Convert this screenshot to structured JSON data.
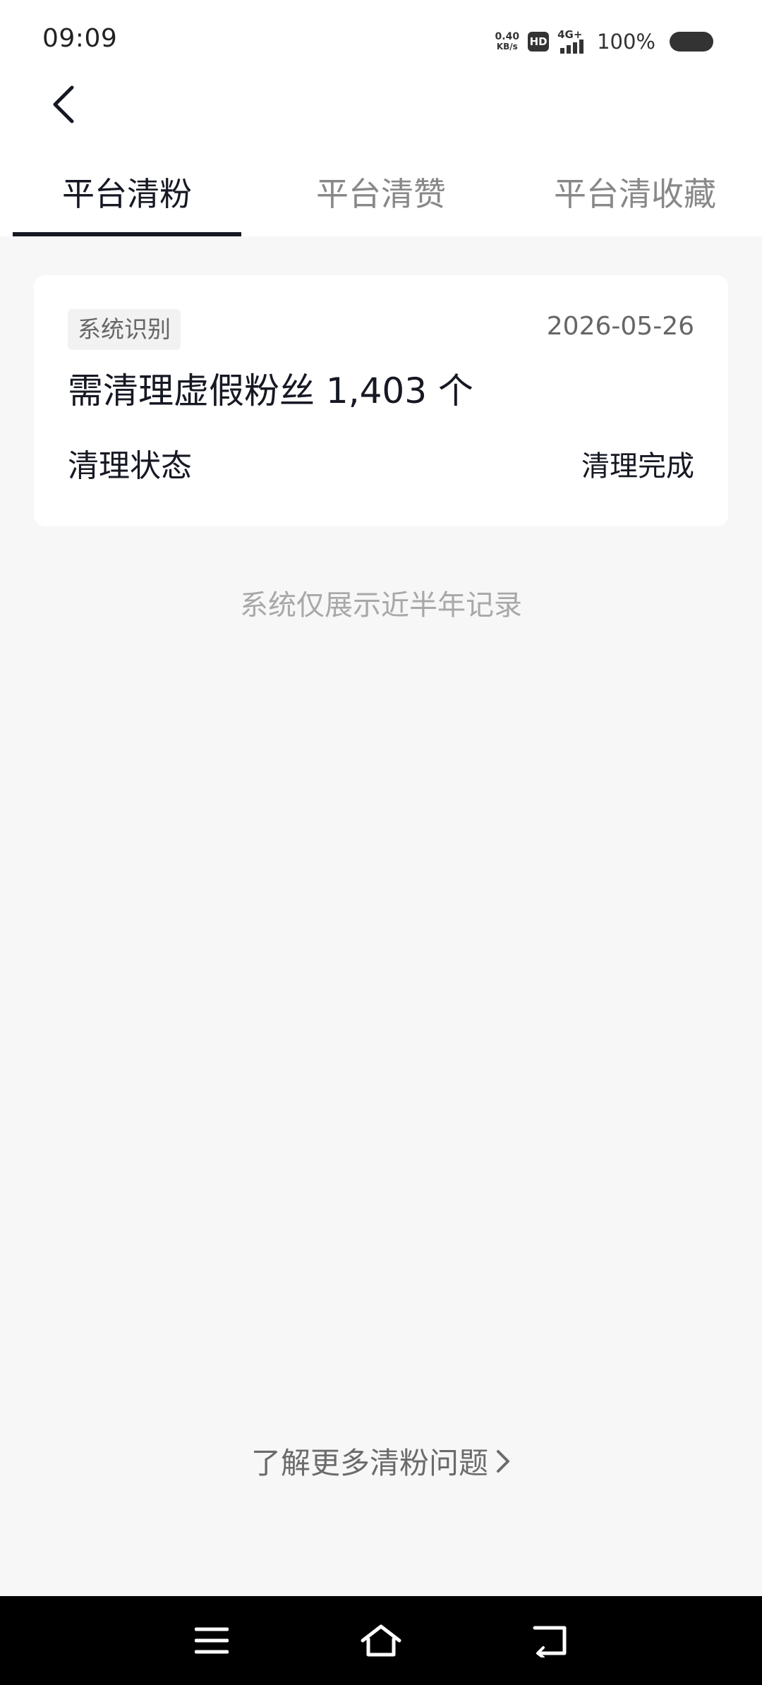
{
  "status_bar": {
    "time": "09:09",
    "net_speed_value": "0.40",
    "net_speed_unit": "KB/s",
    "hd_label": "HD",
    "network_type": "4G+",
    "battery_percent": "100%"
  },
  "header": {
    "back_icon": "chevron-left-icon"
  },
  "tabs": [
    {
      "label": "平台清粉",
      "active": true
    },
    {
      "label": "平台清赞",
      "active": false
    },
    {
      "label": "平台清收藏",
      "active": false
    }
  ],
  "record_card": {
    "tag": "系统识别",
    "date": "2026-05-26",
    "title": "需清理虚假粉丝 1,403 个",
    "status_label": "清理状态",
    "status_value": "清理完成"
  },
  "notice": "系统仅展示近半年记录",
  "more_link": {
    "label": "了解更多清粉问题",
    "icon": "chevron-right-icon"
  },
  "navigation_bar": {
    "menu_icon": "menu-icon",
    "home_icon": "home-icon",
    "back_icon": "back-icon"
  },
  "colors": {
    "primary_text": "#161823",
    "inactive_tab": "#888888",
    "muted_text": "#a8a8a8",
    "background": "#f7f7f7"
  }
}
